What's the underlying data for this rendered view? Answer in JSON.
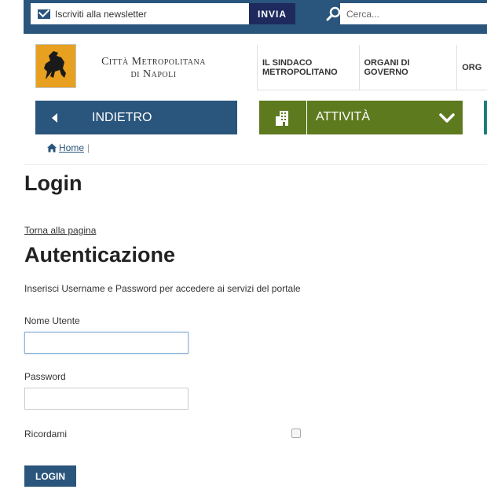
{
  "topbar": {
    "newsletter_label": "Iscriviti alla newsletter",
    "submit_label": "INVIA",
    "search_placeholder": "Cerca..."
  },
  "header": {
    "org_line1": "Città Metropolitana",
    "org_line2": "di Napoli",
    "nav": [
      {
        "label": "IL SINDACO METROPOLITANO"
      },
      {
        "label": "ORGANI DI GOVERNO"
      },
      {
        "label": "ORG"
      }
    ]
  },
  "navbar": {
    "back_label": "INDIETRO",
    "menu_label": "ATTIVITÀ"
  },
  "breadcrumb": {
    "home_label": "Home",
    "separator": "|"
  },
  "main": {
    "title": "Login",
    "back_link": "Torna alla pagina",
    "section_title": "Autenticazione",
    "intro": "Inserisci Username e Password per accedere ai servizi del portale",
    "username_label": "Nome Utente",
    "username_value": "",
    "password_label": "Password",
    "password_value": "",
    "remember_label": "Ricordami",
    "submit_label": "LOGIN"
  },
  "colors": {
    "primary": "#2a557c",
    "dark_navy": "#1e2a5e",
    "olive": "#5e7a1f",
    "teal": "#1a7e7a",
    "logo_bg": "#e8a020"
  }
}
